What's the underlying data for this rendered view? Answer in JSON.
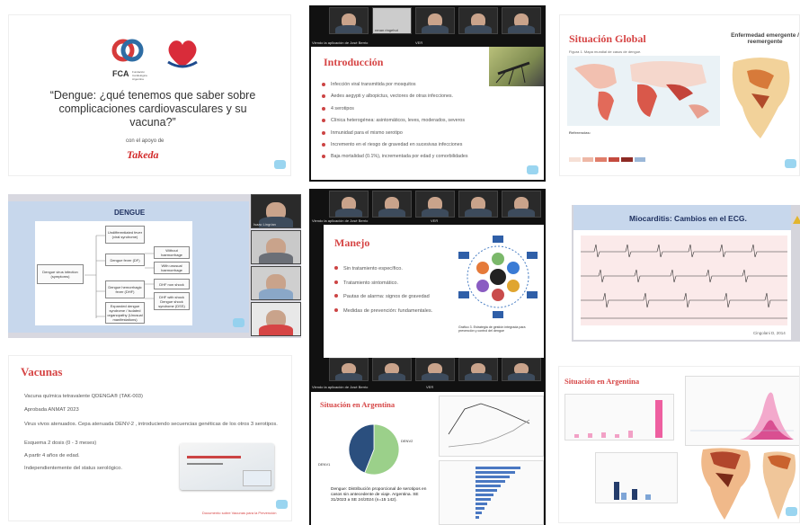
{
  "tile1": {
    "org_short": "FCA",
    "org_sub": "Fundación Cardiológica Argentina",
    "title": "“Dengue: ¿qué tenemos que saber sobre complicaciones cardiovasculares y su vacuna?”",
    "support": "con el apoyo de",
    "sponsor": "Takeda"
  },
  "tile2": {
    "participants": [
      "",
      "renan ringehut",
      "",
      ""
    ],
    "window_caption": "Viendo la aplicación de José Berrio",
    "view_btn": "VER",
    "title": "Introducción",
    "bullets": [
      "Infección viral transmitida por mosquitos",
      "Aedes aegypti y albopictus, vectores de otras infecciones.",
      "4 serotipos",
      "Clínica heterogénea: asintomáticos, leves, moderados, severos",
      "Inmunidad para el mismo serotipo",
      "Incremento en el riesgo de gravedad en sucesivas infecciones",
      "Baja mortalidad (0.1%), incrementada por edad y comorbilidades"
    ]
  },
  "tile3": {
    "title": "Situación Global",
    "subtitle": "Enfermedad emergente / reemergente",
    "fig_caption": "Figura 1. Mapa mundial de casos de dengue.",
    "refs_label": "Referencias:"
  },
  "tile4": {
    "title": "DENGUE",
    "root": "Dengue virus infection (symptoms)",
    "col2": [
      "Undifferentiated fever (viral syndrome)",
      "Dengue fever (DF)",
      "Dengue hemorrhagic fever (DHF)",
      "Expanded dengue syndrome / Isolated organopathy (Unusual manifestations)"
    ],
    "col3": [
      "Without haemorrhage",
      "With unusual haemorrhage",
      "DHF non shock",
      "DHF with shock Dengue shock syndrome (DSS)"
    ],
    "participants": [
      "Isaac Lingrian",
      "",
      "",
      ""
    ]
  },
  "tile5": {
    "window_caption": "Viendo la aplicación de José Berrio",
    "view_btn": "VER",
    "title": "Manejo",
    "bullets": [
      "Sin tratamiento específico.",
      "Tratamiento sintomático.",
      "Pautas de alarma: signos de gravedad",
      "Medidas de prevención: fundamentales."
    ],
    "graphic_caption": "Gráfico 3. Estrategia de gestión integrada para prevención y control del dengue"
  },
  "tile6": {
    "title": "Miocarditis: Cambios en el ECG.",
    "credit": "Cingolani D, 2014"
  },
  "tile7": {
    "title": "Vacunas",
    "lines": [
      "Vacuna química tetravalente QDENGA® (TAK-003)",
      "Aprobada ANMAT 2023",
      "Virus vivos atenuados. Cepa atenuada DENV-2 , introduciendo secuencias genéticas de los otros 3 serotipos.",
      "Esquema 2 dosis (0 - 3 meses)",
      "A partir 4 años de edad.",
      "Independientemente del status serológico."
    ],
    "footer": "Documento sobre Vacunas para la Prevención"
  },
  "tile8": {
    "window_caption": "Viendo la aplicación de José Berrio",
    "view_btn": "VER",
    "title": "Situación en Argentina",
    "pie_caption": "Dengue: Distribución proporcional de serotipos en casos sin antecedente de viaje. Argentina. SE 31/2023 a SE 24/2024 (n=15 142).",
    "pie_legend": [
      "DENV1",
      "DENV2"
    ]
  },
  "tile9": {
    "title": "Situación en Argentina"
  },
  "chart_data": [
    {
      "type": "pie",
      "categories": [
        "DENV1",
        "DENV2"
      ],
      "values": [
        56,
        44
      ],
      "title": "",
      "colors": [
        "#9bd08a",
        "#2b4f7e"
      ]
    }
  ],
  "colors": {
    "accent_red": "#d64545",
    "slide_blue": "#2d3c74",
    "icon_blue": "#8fd0ee"
  }
}
